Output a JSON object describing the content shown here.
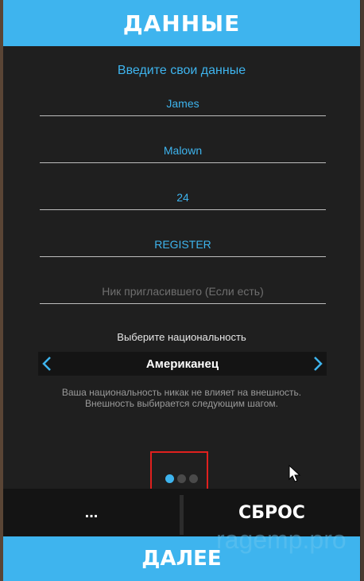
{
  "header": {
    "title": "ДАННЫЕ"
  },
  "form": {
    "subtitle": "Введите свои данные",
    "fields": [
      {
        "value": "James",
        "placeholder": ""
      },
      {
        "value": "Malown",
        "placeholder": ""
      },
      {
        "value": "24",
        "placeholder": ""
      },
      {
        "value": "REGISTER",
        "placeholder": ""
      },
      {
        "value": "",
        "placeholder": "Ник пригласившего (Если есть)"
      }
    ]
  },
  "nationality": {
    "label": "Выберите национальность",
    "selected": "Американец",
    "hint_line1": "Ваша национальность никак не влияет на внешность.",
    "hint_line2": "Внешность выбирается следующим шагом."
  },
  "pager": {
    "total": 3,
    "active": 1
  },
  "buttons": {
    "more": "...",
    "reset": "СБРОС",
    "next": "ДАЛЕЕ"
  },
  "watermark": "ragemp.pro",
  "colors": {
    "accent": "#3eb4ee",
    "panel": "#1f1f1f",
    "highlight": "#e0201e"
  }
}
